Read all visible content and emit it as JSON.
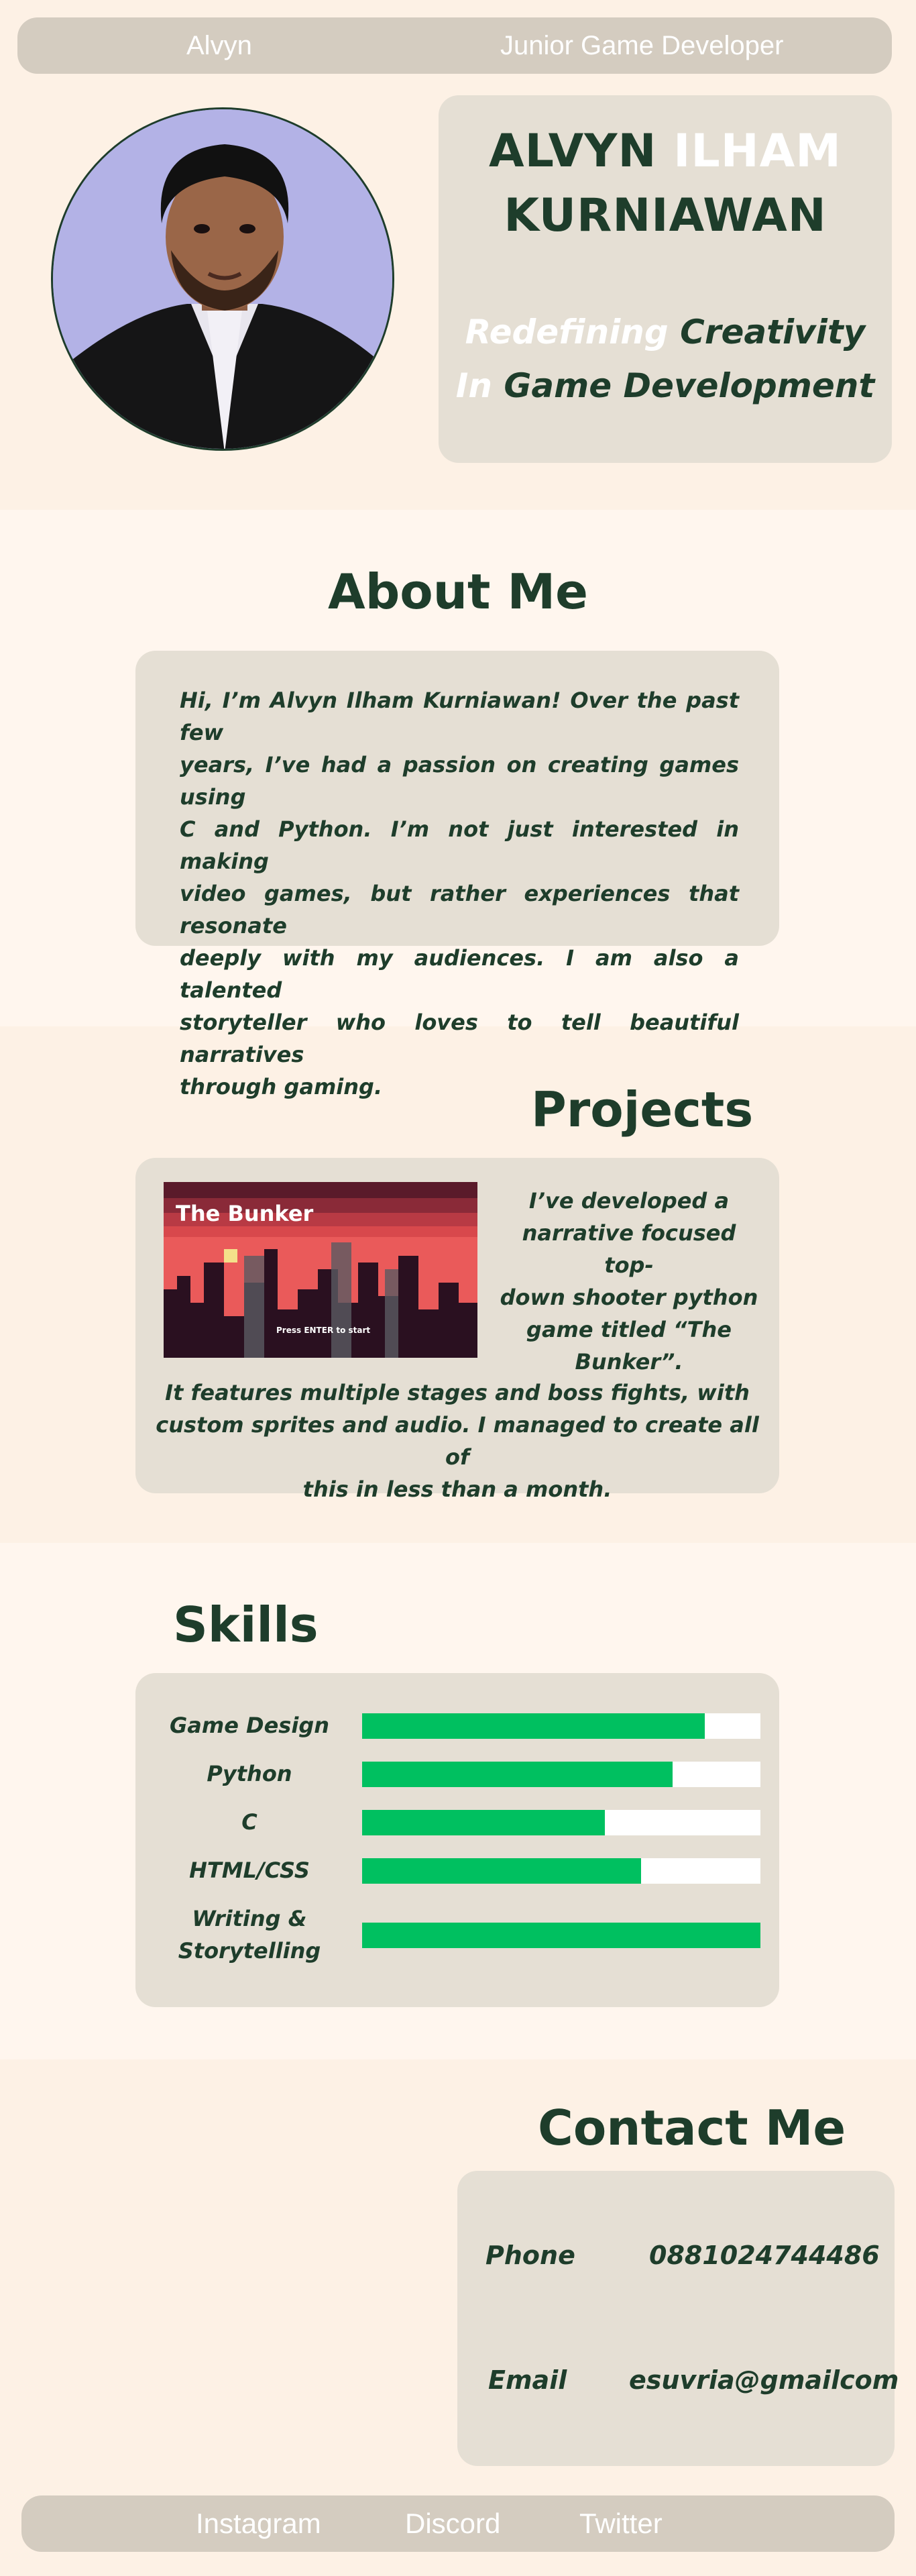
{
  "nav": {
    "name": "Alvyn",
    "role": "Junior Game Developer"
  },
  "hero": {
    "first_name": "ALVYN",
    "middle_name": "ILHAM",
    "last_name": "KURNIAWAN",
    "tag_word1": "Redefining",
    "tag_word2": "Creativity",
    "tag_word3": "In",
    "tag_word4": "Game Development",
    "avatar_icon": "portrait-photo"
  },
  "about": {
    "title": "About Me",
    "lines": [
      "Hi, I’m Alvyn Ilham Kurniawan! Over the past few",
      "years, I’ve had a passion on creating games using",
      "C and Python. I’m not just interested in making",
      "video games, but rather experiences that resonate",
      "deeply with my audiences. I am also a talented",
      "storyteller who loves to tell beautiful narratives",
      "through gaming."
    ]
  },
  "projects": {
    "title": "Projects",
    "thumb_title": "The Bunker",
    "thumb_caption": "Press ENTER to start",
    "side_lines": [
      "I’ve developed a",
      "narrative focused top-",
      "down shooter python",
      "game titled “The",
      "Bunker”."
    ],
    "bottom_lines": [
      "It features multiple stages and boss fights, with",
      "custom sprites and audio. I managed to create all of",
      "this in less than a month."
    ]
  },
  "skills": {
    "title": "Skills",
    "items": [
      {
        "label": "Game Design",
        "label2": "",
        "level": 0.86
      },
      {
        "label": "Python",
        "label2": "",
        "level": 0.78
      },
      {
        "label": "C",
        "label2": "",
        "level": 0.61
      },
      {
        "label": "HTML/CSS",
        "label2": "",
        "level": 0.7
      },
      {
        "label": "Writing &",
        "label2": "Storytelling",
        "level": 1.0
      }
    ],
    "fill_color": "#00c060"
  },
  "contact": {
    "title": "Contact Me",
    "phone_label": "Phone",
    "phone_value": "0881024744486",
    "email_label": "Email",
    "email_value": "esuvria@gmailcom"
  },
  "footer": {
    "links": [
      "Instagram",
      "Discord",
      "Twitter"
    ]
  }
}
